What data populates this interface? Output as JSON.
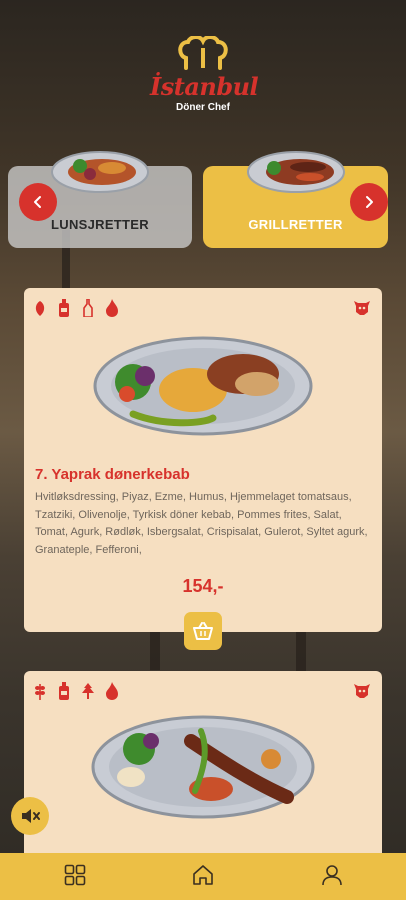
{
  "brand": {
    "name": "İstanbul",
    "subtitle": "Döner Chef"
  },
  "categories": [
    {
      "label": "LUNSJRETTER",
      "active": false
    },
    {
      "label": "GRILLRETTER",
      "active": true
    }
  ],
  "menu_items": [
    {
      "title": "7. Yaprak dønerkebab",
      "description": "Hvitløksdressing, Piyaz, Ezme, Humus, Hjemmelaget tomatsaus, Tzatziki, Olivenolje, Tyrkisk döner kebab, Pommes frites, Salat, Tomat, Agurk, Rødløk, Isbergsalat, Crispisalat, Gulerot, Syltet agurk, Granateple, Fefferoni,",
      "price": "154,-",
      "badge_icons": [
        "chili-icon",
        "sauce-bottle-icon",
        "ketchup-bottle-icon",
        "fire-icon"
      ],
      "meat_icon": "cow-icon"
    },
    {
      "title": "",
      "description": "",
      "price": "",
      "badge_icons": [
        "wheat-icon",
        "sauce-bottle-icon",
        "herb-icon",
        "fire-icon"
      ],
      "meat_icon": "cow-icon"
    }
  ],
  "bottom_nav": [
    {
      "name": "menu",
      "icon": "grid-icon"
    },
    {
      "name": "home",
      "icon": "home-icon"
    },
    {
      "name": "profile",
      "icon": "user-icon"
    }
  ],
  "colors": {
    "accent_yellow": "#ecbf45",
    "brand_red": "#d7322c",
    "card_bg": "#f6dfc1"
  }
}
